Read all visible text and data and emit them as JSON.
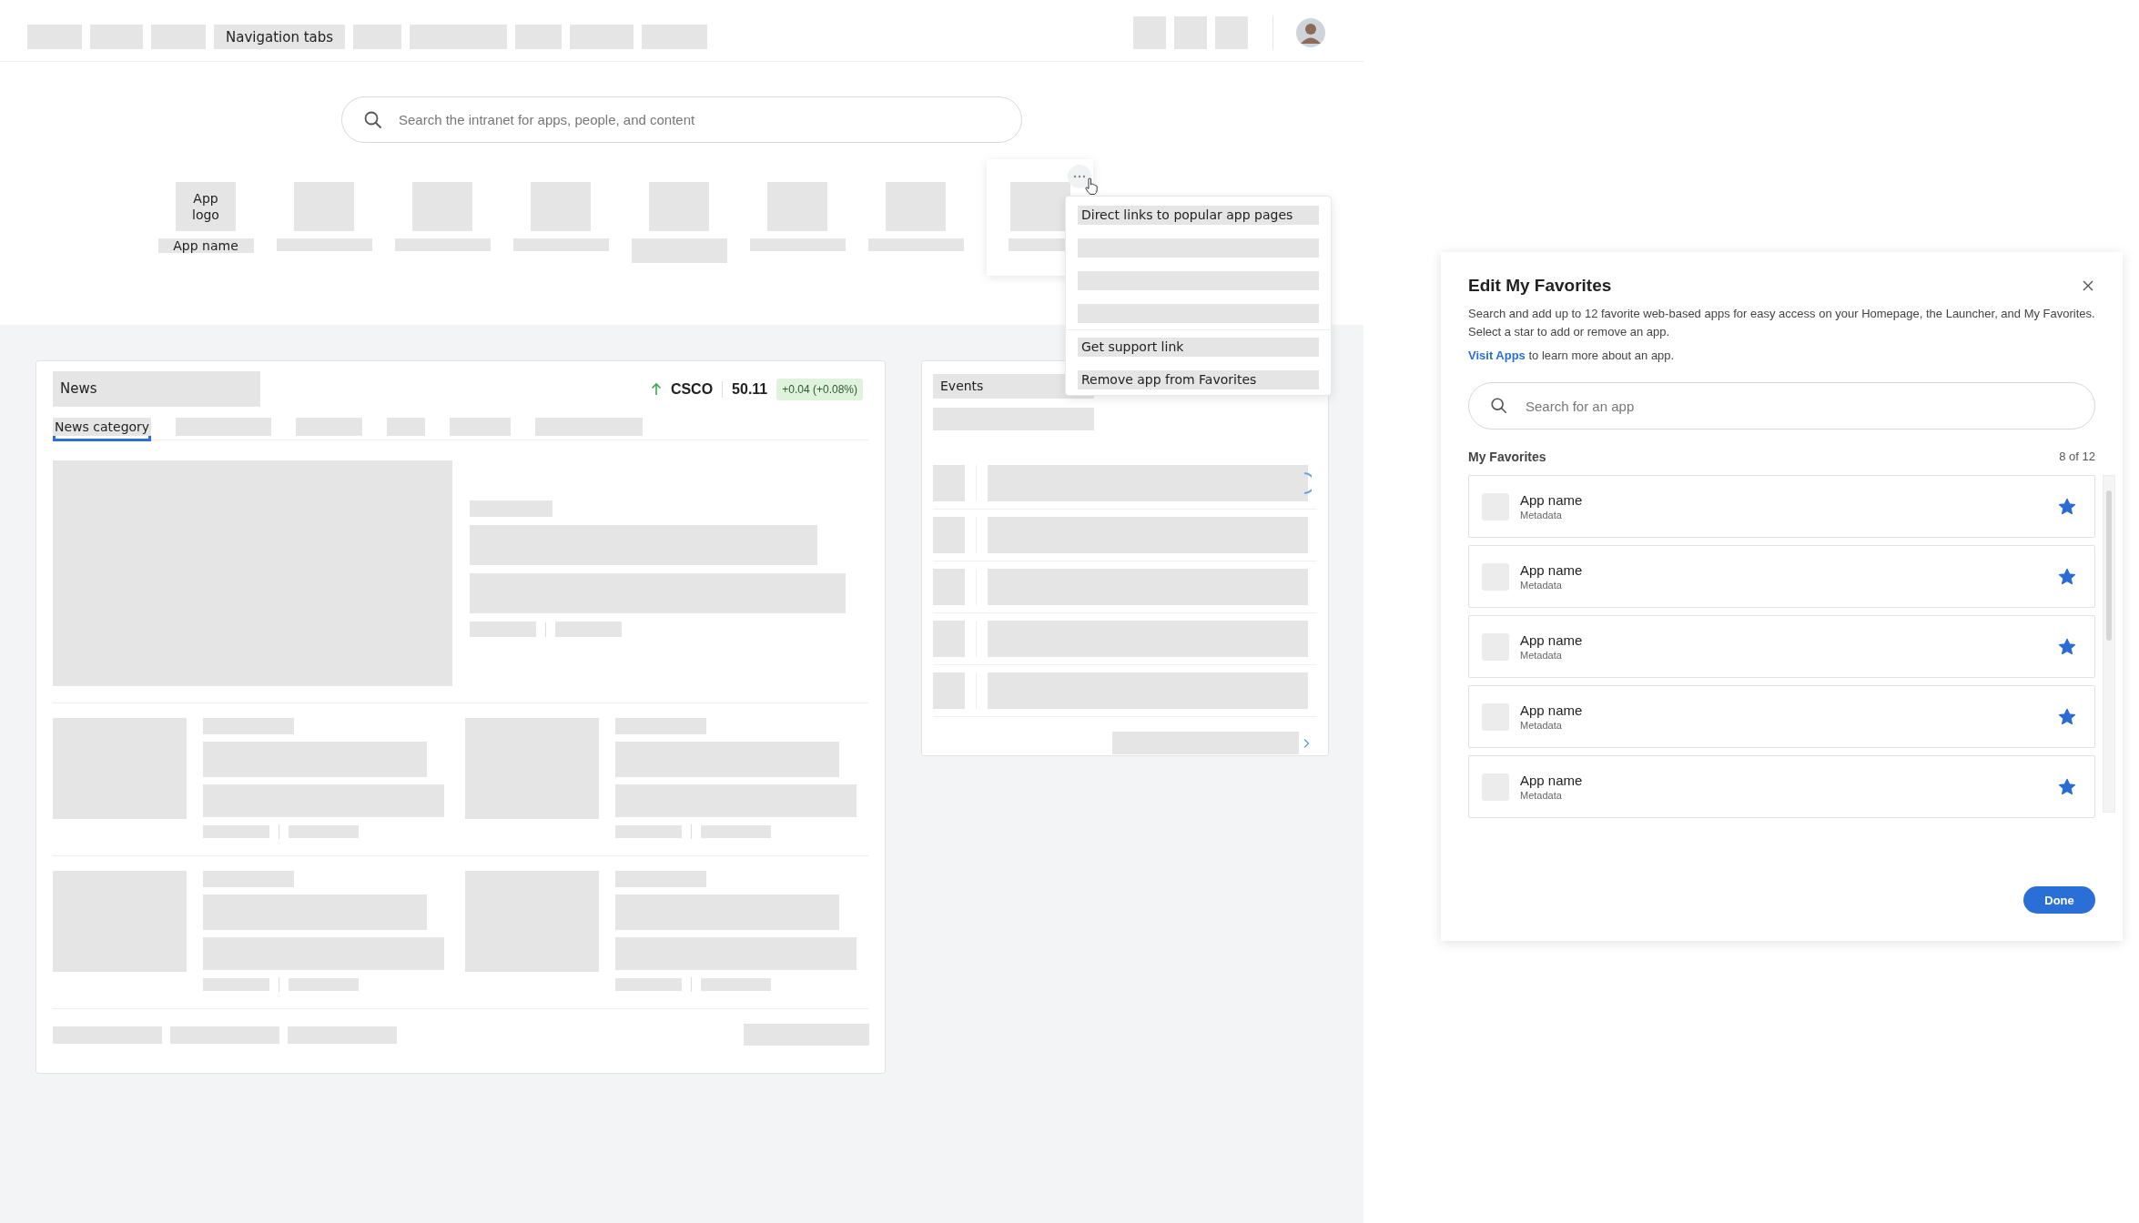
{
  "nav": {
    "label": "Navigation tabs"
  },
  "search": {
    "placeholder": "Search the intranet for apps, people, and content"
  },
  "apps": [
    {
      "logo": "App logo",
      "name": "App name"
    }
  ],
  "app_menu": {
    "sections": [
      {
        "items": [
          "Direct links to popular app pages"
        ]
      },
      {
        "items": [
          "Get support link",
          "Remove app from Favorites"
        ]
      }
    ]
  },
  "news": {
    "title": "News",
    "stock": {
      "symbol": "CSCO",
      "price": "50.11",
      "change": "+0.04 (+0.08%)",
      "rising": true
    },
    "categories": [
      {
        "label": "News category",
        "selected": true
      }
    ]
  },
  "events": {
    "title": "Events"
  },
  "dialog": {
    "title": "Edit My Favorites",
    "description": "Search and add up to 12 favorite web-based apps for easy access on your Homepage, the Launcher, and My Favorites. Select a star to add or remove an app.",
    "link": "Visit Apps",
    "link_text": "to learn more about an app.",
    "search_placeholder": "Search for an app",
    "section": "My Favorites",
    "count": "8 of 12",
    "favorites": [
      {
        "name": "App name",
        "meta": "Metadata",
        "starred": true
      },
      {
        "name": "App name",
        "meta": "Metadata",
        "starred": true
      },
      {
        "name": "App name",
        "meta": "Metadata",
        "starred": true
      },
      {
        "name": "App name",
        "meta": "Metadata",
        "starred": true
      },
      {
        "name": "App name",
        "meta": "Metadata",
        "starred": true
      }
    ],
    "done": "Done"
  }
}
